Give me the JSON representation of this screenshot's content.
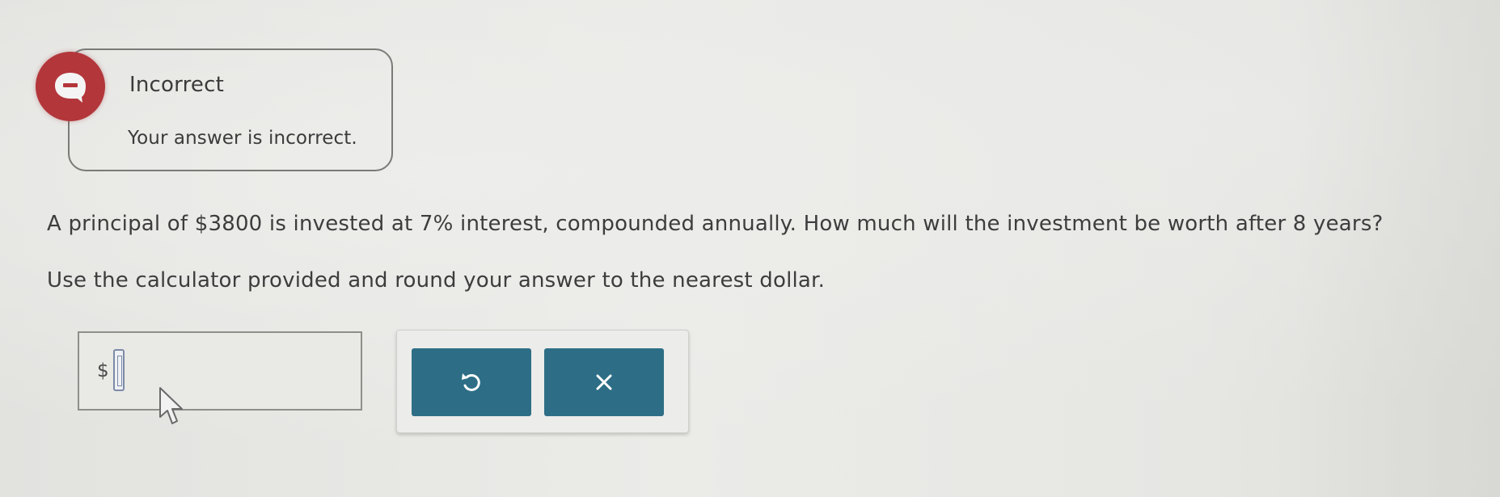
{
  "feedback": {
    "status_title": "Incorrect",
    "message": "Your answer is incorrect.",
    "status_color": "#b3363b"
  },
  "question": {
    "prompt": "A principal of $3800 is invested at 7% interest, compounded annually. How much will the investment be worth after 8 years?",
    "instruction": "Use the calculator provided and round your answer to the nearest dollar."
  },
  "answer": {
    "currency_symbol": "$",
    "value": ""
  },
  "tools": {
    "undo_icon": "undo-icon",
    "clear_icon": "close-icon",
    "button_color": "#2d6e86"
  }
}
